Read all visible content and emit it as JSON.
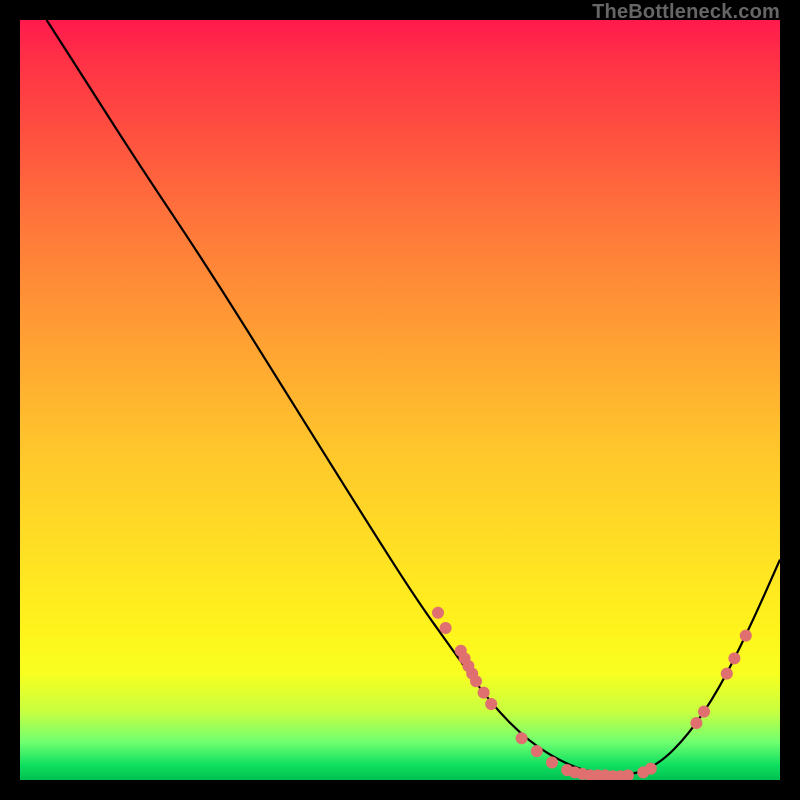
{
  "watermark": "TheBottleneck.com",
  "chart_data": {
    "type": "line",
    "title": "",
    "xlabel": "",
    "ylabel": "",
    "xlim": [
      0,
      100
    ],
    "ylim": [
      0,
      100
    ],
    "curve": [
      {
        "x": 3.5,
        "y": 100
      },
      {
        "x": 8,
        "y": 93
      },
      {
        "x": 15,
        "y": 82
      },
      {
        "x": 25,
        "y": 67
      },
      {
        "x": 35,
        "y": 51
      },
      {
        "x": 45,
        "y": 35
      },
      {
        "x": 52,
        "y": 24
      },
      {
        "x": 57,
        "y": 17
      },
      {
        "x": 62,
        "y": 10
      },
      {
        "x": 67,
        "y": 5
      },
      {
        "x": 72,
        "y": 2
      },
      {
        "x": 76,
        "y": 0.8
      },
      {
        "x": 80,
        "y": 0.5
      },
      {
        "x": 84,
        "y": 2
      },
      {
        "x": 88,
        "y": 6
      },
      {
        "x": 92,
        "y": 12
      },
      {
        "x": 96,
        "y": 20
      },
      {
        "x": 100,
        "y": 29
      }
    ],
    "scatter_points": [
      {
        "x": 55,
        "y": 22
      },
      {
        "x": 56,
        "y": 20
      },
      {
        "x": 58,
        "y": 17
      },
      {
        "x": 58.5,
        "y": 16
      },
      {
        "x": 59,
        "y": 15
      },
      {
        "x": 59.5,
        "y": 14
      },
      {
        "x": 60,
        "y": 13
      },
      {
        "x": 61,
        "y": 11.5
      },
      {
        "x": 62,
        "y": 10
      },
      {
        "x": 66,
        "y": 5.5
      },
      {
        "x": 68,
        "y": 3.8
      },
      {
        "x": 70,
        "y": 2.3
      },
      {
        "x": 72,
        "y": 1.3
      },
      {
        "x": 73,
        "y": 1
      },
      {
        "x": 74,
        "y": 0.8
      },
      {
        "x": 75,
        "y": 0.6
      },
      {
        "x": 76,
        "y": 0.6
      },
      {
        "x": 77,
        "y": 0.6
      },
      {
        "x": 78,
        "y": 0.5
      },
      {
        "x": 79,
        "y": 0.5
      },
      {
        "x": 80,
        "y": 0.6
      },
      {
        "x": 82,
        "y": 1
      },
      {
        "x": 83,
        "y": 1.5
      },
      {
        "x": 89,
        "y": 7.5
      },
      {
        "x": 90,
        "y": 9
      },
      {
        "x": 93,
        "y": 14
      },
      {
        "x": 94,
        "y": 16
      },
      {
        "x": 95.5,
        "y": 19
      }
    ],
    "curve_color": "#000000",
    "point_color": "#e07070",
    "point_radius_px": 6
  }
}
